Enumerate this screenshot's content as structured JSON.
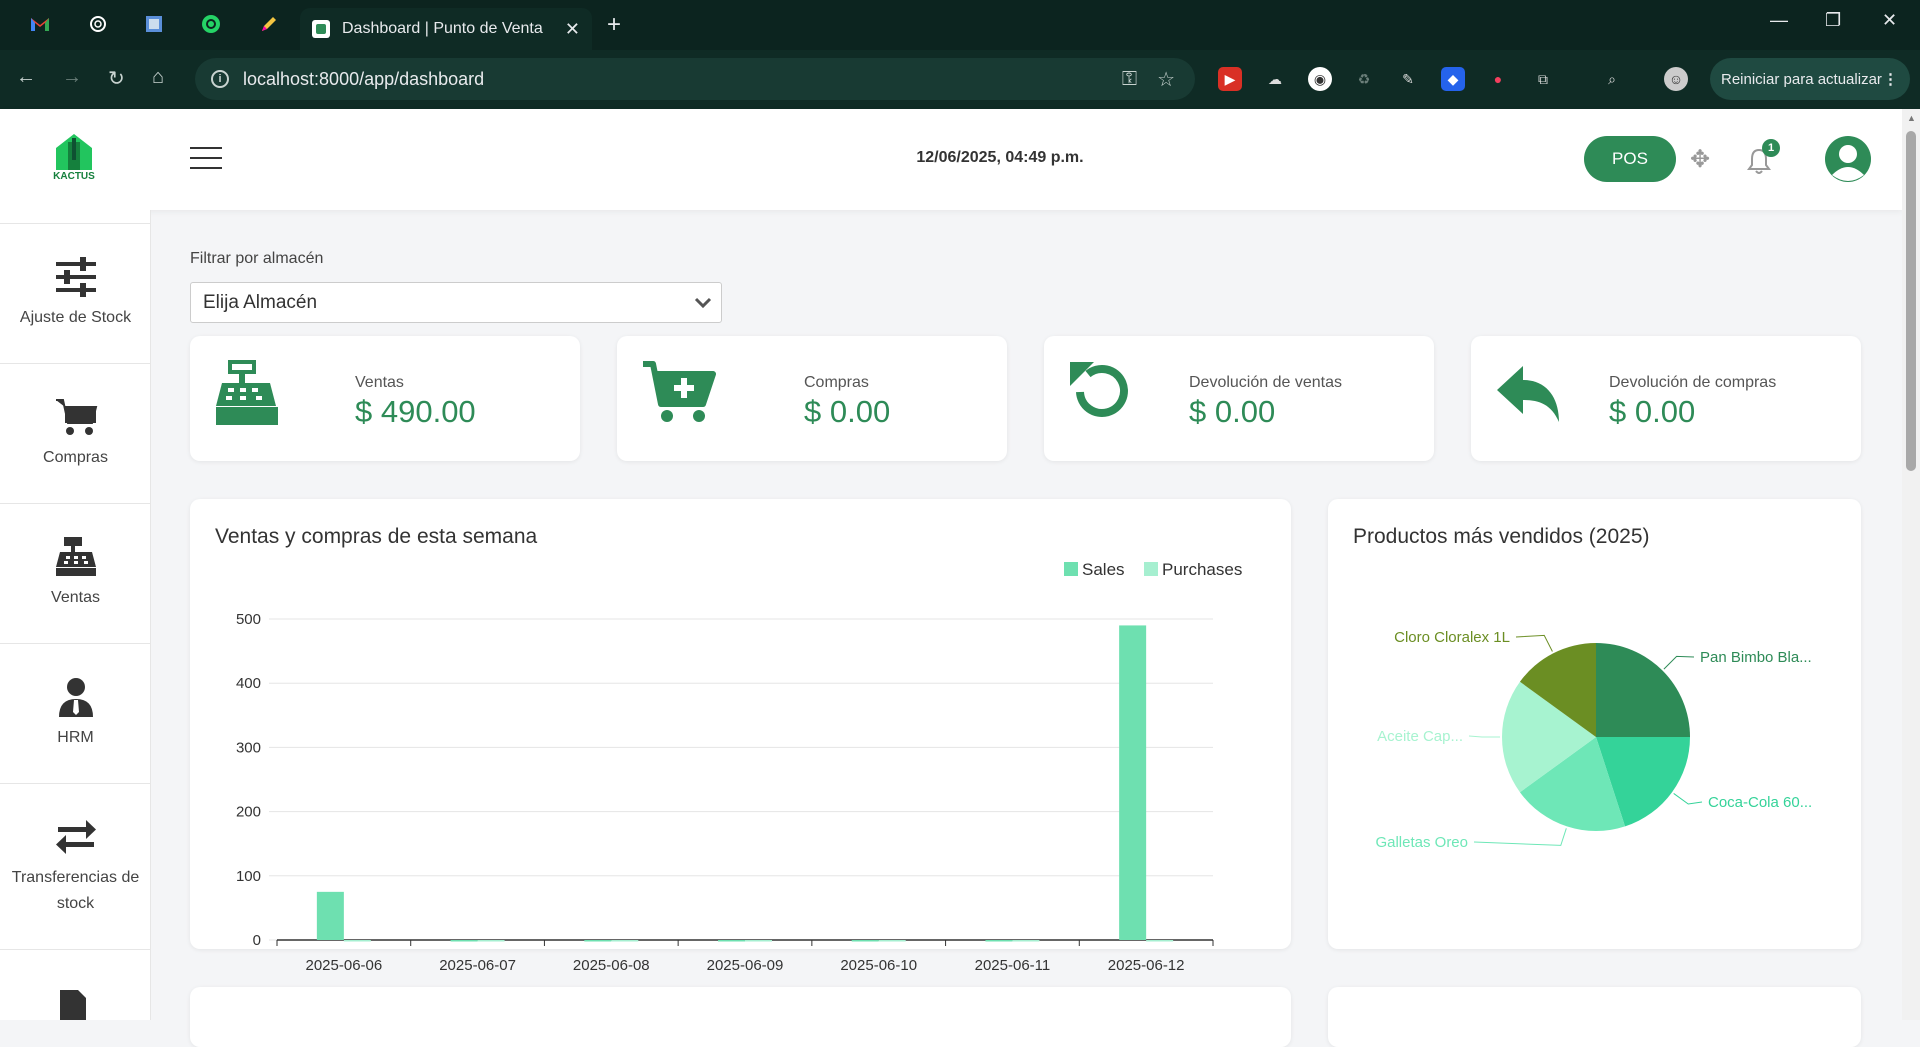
{
  "browser": {
    "active_tab_title": "Dashboard | Punto de Venta",
    "url": "localhost:8000/app/dashboard",
    "update_button": "Reiniciar para actualizar"
  },
  "header": {
    "datetime": "12/06/2025, 04:49 p.m.",
    "pos_button": "POS",
    "notification_count": "1"
  },
  "sidebar": {
    "items": [
      {
        "label": "Ajuste de Stock",
        "icon": "sliders-icon"
      },
      {
        "label": "Compras",
        "icon": "cart-icon"
      },
      {
        "label": "Ventas",
        "icon": "cash-register-icon"
      },
      {
        "label": "HRM",
        "icon": "user-tie-icon"
      },
      {
        "label": "Transferencias de stock",
        "icon": "exchange-icon"
      }
    ]
  },
  "filter": {
    "label": "Filtrar por almacén",
    "selected": "Elija Almacén"
  },
  "stats": [
    {
      "label": "Ventas",
      "value": "$ 490.00",
      "icon": "cash-register-icon"
    },
    {
      "label": "Compras",
      "value": "$ 0.00",
      "icon": "cart-plus-icon"
    },
    {
      "label": "Devolución de ventas",
      "value": "$ 0.00",
      "icon": "undo-icon"
    },
    {
      "label": "Devolución de compras",
      "value": "$ 0.00",
      "icon": "reply-icon"
    }
  ],
  "colors": {
    "primary": "#2e8b57",
    "sales": "#6ee0b0",
    "purchases": "#a6efd0"
  },
  "chart_data": [
    {
      "type": "bar",
      "title": "Ventas y compras de esta semana",
      "categories": [
        "2025-06-06",
        "2025-06-07",
        "2025-06-08",
        "2025-06-09",
        "2025-06-10",
        "2025-06-11",
        "2025-06-12"
      ],
      "series": [
        {
          "name": "Sales",
          "values": [
            75,
            0,
            0,
            0,
            0,
            0,
            490
          ]
        },
        {
          "name": "Purchases",
          "values": [
            0,
            0,
            0,
            0,
            0,
            0,
            0
          ]
        }
      ],
      "yticks": [
        "0",
        "100",
        "200",
        "300",
        "400",
        "500"
      ],
      "ylim": [
        0,
        500
      ],
      "legend": "top-right",
      "grid": true
    },
    {
      "type": "pie",
      "title": "Productos más vendidos (2025)",
      "slices": [
        {
          "label": "Pan Bimbo Bla...",
          "value": 25,
          "color": "#2e8b57"
        },
        {
          "label": "Coca-Cola 60...",
          "value": 20,
          "color": "#34d399"
        },
        {
          "label": "Galletas Oreo",
          "value": 20,
          "color": "#6ee7b7"
        },
        {
          "label": "Aceite Cap...",
          "value": 20,
          "color": "#a7f3d0"
        },
        {
          "label": "Cloro Cloralex 1L",
          "value": 15,
          "color": "#6b8e23"
        }
      ]
    }
  ]
}
